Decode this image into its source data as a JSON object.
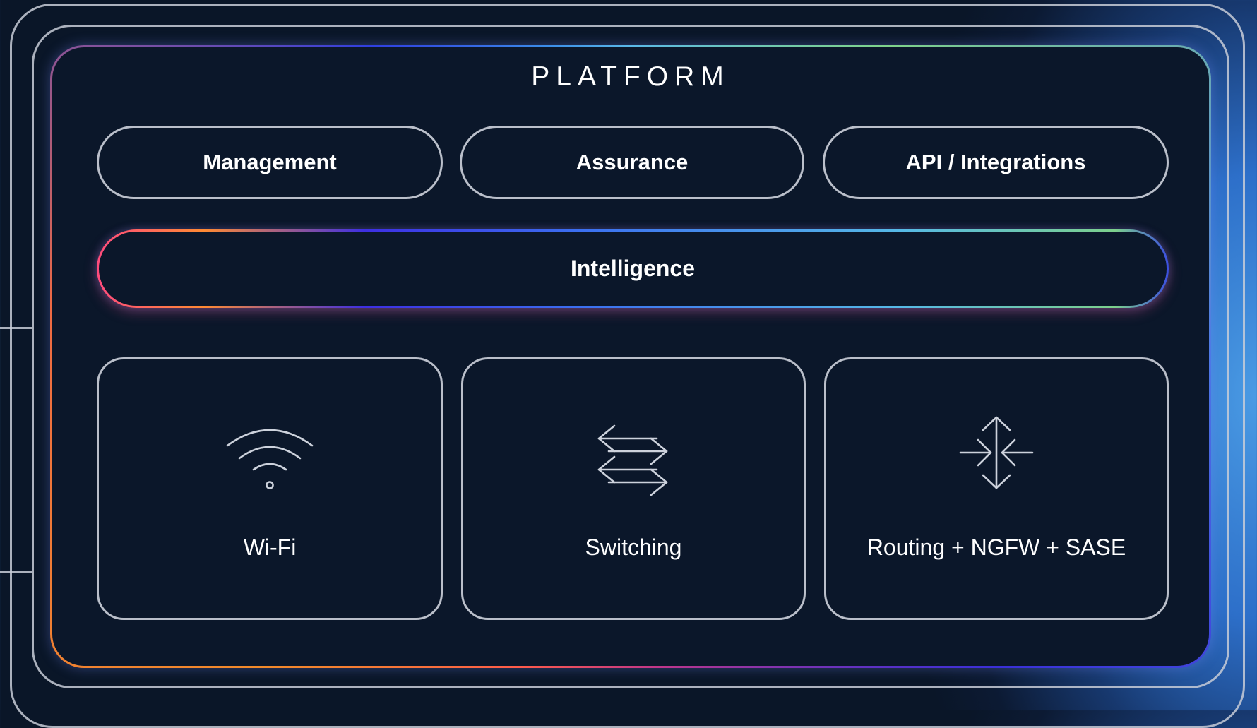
{
  "platform": {
    "title": "PLATFORM"
  },
  "top_pills": [
    {
      "label": "Management"
    },
    {
      "label": "Assurance"
    },
    {
      "label": "API / Integrations"
    }
  ],
  "intelligence": {
    "label": "Intelligence"
  },
  "cards": [
    {
      "label": "Wi-Fi",
      "icon": "wifi-icon"
    },
    {
      "label": "Switching",
      "icon": "switching-arrows-icon"
    },
    {
      "label": "Routing + NGFW + SASE",
      "icon": "routing-arrows-icon"
    }
  ],
  "colors": {
    "background": "#0a1628",
    "panel": "#0b172a",
    "outline": "#cdd2dc",
    "text": "#ffffff",
    "accent_blue": "#4a9be4",
    "accent_orange": "#f18a2a",
    "accent_pink": "#ff4b7d",
    "accent_violet": "#3d2fe3",
    "accent_green": "#7cd08c"
  }
}
